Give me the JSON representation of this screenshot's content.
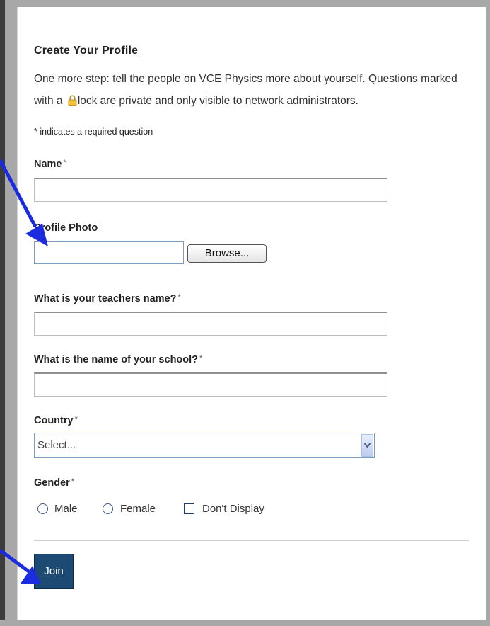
{
  "colors": {
    "frame": "#a8a8a8",
    "join_button_bg": "#1c4a72",
    "annotation_arrow": "#1a2be0",
    "lock": "#e8b020"
  },
  "form": {
    "title": "Create Your Profile",
    "intro_part1": "One more step: tell the people on VCE Physics more about yourself. Questions marked with a ",
    "lock_icon": "padlock-icon",
    "intro_part2": "lock are private and only visible to network administrators.",
    "required_note": "* indicates a required question",
    "required_marker": "*",
    "fields": {
      "name": {
        "label": "Name",
        "value": ""
      },
      "profile_photo": {
        "label": "Profile Photo",
        "value": "",
        "browse_label": "Browse..."
      },
      "teacher": {
        "label": "What is your teachers name?",
        "value": ""
      },
      "school": {
        "label": "What is the name of your school?",
        "value": ""
      },
      "country": {
        "label": "Country",
        "selected": "Select..."
      },
      "gender": {
        "label": "Gender",
        "options": [
          {
            "label": "Male",
            "type": "radio",
            "checked": false
          },
          {
            "label": "Female",
            "type": "radio",
            "checked": false
          },
          {
            "label": "Don't Display",
            "type": "checkbox",
            "checked": false
          }
        ]
      }
    },
    "submit_label": "Join"
  }
}
